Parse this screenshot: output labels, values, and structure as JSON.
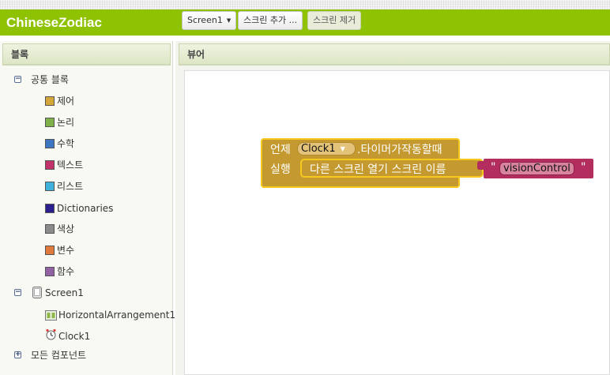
{
  "app": {
    "title": "ChineseZodiac"
  },
  "toolbar": {
    "screen_select": "Screen1",
    "add_screen": "스크린 추가 ...",
    "remove_screen": "스크린 제거"
  },
  "blocks_panel": {
    "header": "블록",
    "builtin": {
      "label": "공통 블록",
      "items": [
        {
          "label": "제어",
          "color": "#d4a63a"
        },
        {
          "label": "논리",
          "color": "#7fb04a"
        },
        {
          "label": "수학",
          "color": "#3e76c1"
        },
        {
          "label": "텍스트",
          "color": "#c2336b"
        },
        {
          "label": "리스트",
          "color": "#3fb1db"
        },
        {
          "label": "Dictionaries",
          "color": "#2b1f8f"
        },
        {
          "label": "색상",
          "color": "#8b8b8b"
        },
        {
          "label": "변수",
          "color": "#e07a3c"
        },
        {
          "label": "함수",
          "color": "#9062a4"
        }
      ]
    },
    "screen": {
      "label": "Screen1",
      "children": [
        {
          "label": "HorizontalArrangement1",
          "icon": "horizontal-arrangement-icon"
        },
        {
          "label": "Clock1",
          "icon": "clock-icon"
        }
      ]
    },
    "any_component": {
      "label": "모든 컴포넌트"
    }
  },
  "viewer": {
    "header": "뷰어"
  },
  "event_block": {
    "when": "언제",
    "component": "Clock1",
    "event": ".타이머가작동할때",
    "do": "실행",
    "statement": {
      "label": "다른 스크린 열기  스크린 이름"
    },
    "text_block": {
      "open_quote": "\"",
      "value": "visionControl",
      "close_quote": "\""
    }
  }
}
